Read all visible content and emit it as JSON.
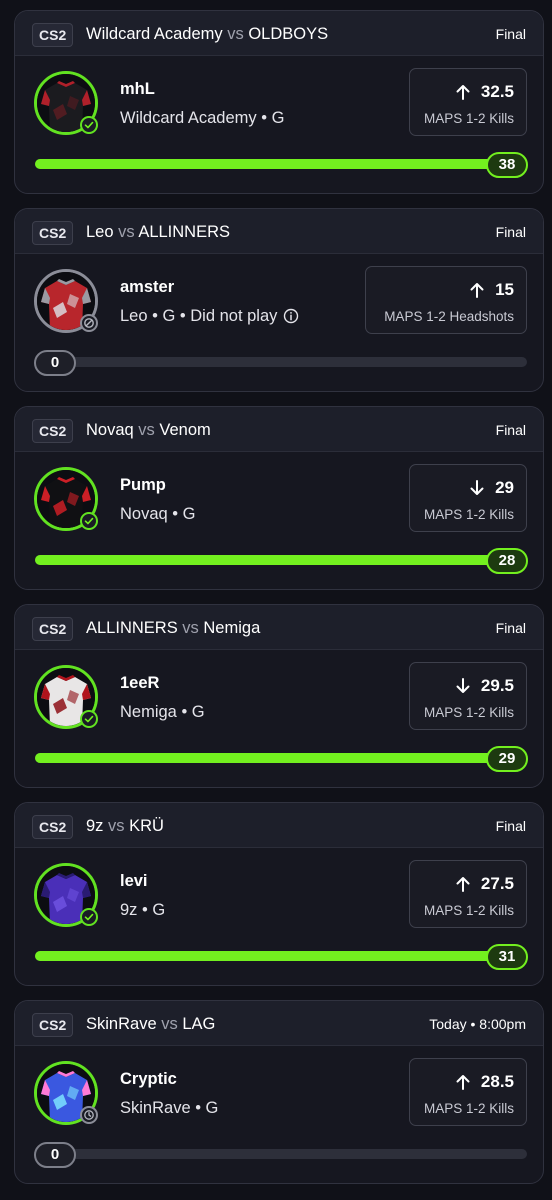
{
  "colors": {
    "accent": "#73f01f",
    "card": "#161720",
    "header": "#1d1f2a",
    "background": "#101118"
  },
  "cards": [
    {
      "game": "CS2",
      "team1": "Wildcard Academy",
      "vs": "vs",
      "team2": "OLDBOYS",
      "status": "Final",
      "player": "mhL",
      "info": "Wildcard Academy • G",
      "did_not_play": false,
      "direction": "up",
      "line": "32.5",
      "stat": "MAPS 1-2 Kills",
      "result": "38",
      "progress": 1.0,
      "jersey": "black-red-camo",
      "badge": "check-icon"
    },
    {
      "game": "CS2",
      "team1": "Leo",
      "vs": "vs",
      "team2": "ALLINNERS",
      "status": "Final",
      "player": "amster",
      "info": "Leo • G • Did not play",
      "did_not_play": true,
      "direction": "up",
      "line": "15",
      "stat": "MAPS 1-2 Headshots",
      "result": "0",
      "progress": 0,
      "jersey": "red-grey",
      "badge": "no-entry-icon"
    },
    {
      "game": "CS2",
      "team1": "Novaq",
      "vs": "vs",
      "team2": "Venom",
      "status": "Final",
      "player": "Pump",
      "info": "Novaq • G",
      "did_not_play": false,
      "direction": "down",
      "line": "29",
      "stat": "MAPS 1-2 Kills",
      "result": "28",
      "progress": 1.0,
      "jersey": "black-red-stripes",
      "badge": "check-icon"
    },
    {
      "game": "CS2",
      "team1": "ALLINNERS",
      "vs": "vs",
      "team2": "Nemiga",
      "status": "Final",
      "player": "1eeR",
      "info": "Nemiga • G",
      "did_not_play": false,
      "direction": "down",
      "line": "29.5",
      "stat": "MAPS 1-2 Kills",
      "result": "29",
      "progress": 1.0,
      "jersey": "white-red",
      "badge": "check-icon"
    },
    {
      "game": "CS2",
      "team1": "9z",
      "vs": "vs",
      "team2": "KRÜ",
      "status": "Final",
      "player": "levi",
      "info": "9z • G",
      "did_not_play": false,
      "direction": "up",
      "line": "27.5",
      "stat": "MAPS 1-2 Kills",
      "result": "31",
      "progress": 1.0,
      "jersey": "purple",
      "badge": "check-icon"
    },
    {
      "game": "CS2",
      "team1": "SkinRave",
      "vs": "vs",
      "team2": "LAG",
      "status": "Today • 8:00pm",
      "player": "Cryptic",
      "info": "SkinRave • G",
      "did_not_play": false,
      "direction": "up",
      "line": "28.5",
      "stat": "MAPS 1-2 Kills",
      "result": "0",
      "progress": 0,
      "jersey": "blue-pink",
      "badge": "clock-icon"
    }
  ]
}
